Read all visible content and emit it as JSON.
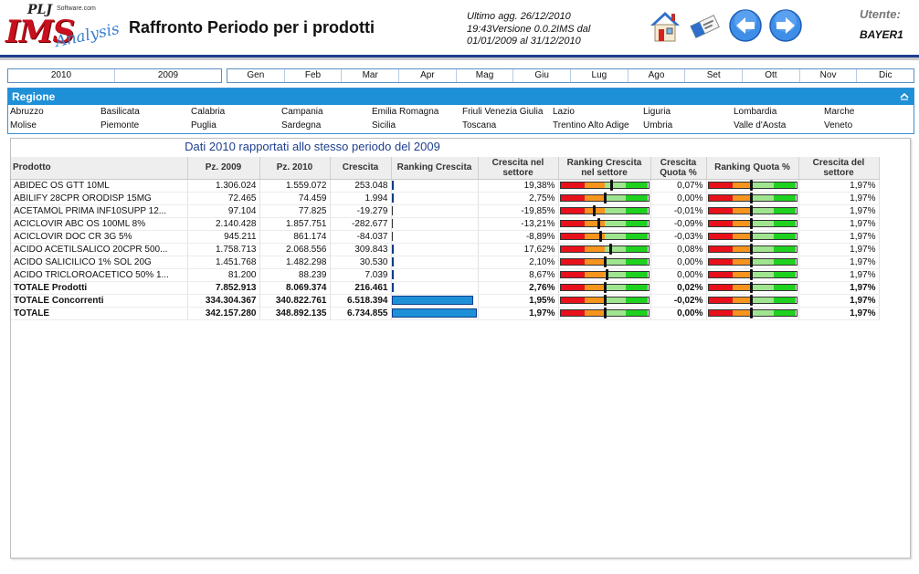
{
  "header": {
    "logo_text": "IMS",
    "logo_company": "PLJ",
    "logo_company_suffix": "Software.com",
    "logo_analysis": "Analysis",
    "title": "Raffronto Periodo per i prodotti",
    "info_line1": "Ultimo agg. 26/12/2010",
    "info_line2": "19:43Versione 0.0.2IMS dal",
    "info_line3": "01/01/2009 al 31/12/2010",
    "user_label": "Utente:",
    "user_name": "BAYER1"
  },
  "toolbar": {
    "home_icon": "home-icon",
    "eraser_icon": "eraser-icon",
    "back_icon": "arrow-left-icon",
    "forward_icon": "arrow-right-icon"
  },
  "years": [
    "2010",
    "2009"
  ],
  "months": [
    "Gen",
    "Feb",
    "Mar",
    "Apr",
    "Mag",
    "Giu",
    "Lug",
    "Ago",
    "Set",
    "Ott",
    "Nov",
    "Dic"
  ],
  "region": {
    "title": "Regione",
    "items": [
      "Abruzzo",
      "Basilicata",
      "Calabria",
      "Campania",
      "Emilia Romagna",
      "Friuli Venezia Giulia",
      "Lazio",
      "Liguria",
      "Lombardia",
      "Marche",
      "Molise",
      "Piemonte",
      "Puglia",
      "Sardegna",
      "Sicilia",
      "Toscana",
      "Trentino Alto Adige",
      "Umbria",
      "Valle d'Aosta",
      "Veneto"
    ]
  },
  "table": {
    "title": "Dati 2010 rapportati allo stesso periodo del 2009",
    "columns": [
      "Prodotto",
      "Pz. 2009",
      "Pz. 2010",
      "Crescita",
      "Ranking Crescita",
      "Crescita nel settore",
      "Ranking Crescita nel settore",
      "Crescita Quota %",
      "Ranking Quota %",
      "Crescita del settore"
    ],
    "rows": [
      {
        "name": "ABIDEC OS GTT 10ML",
        "pz2009": "1.306.024",
        "pz2010": "1.559.072",
        "crescita": "253.048",
        "rank": 0.03,
        "crescita_settore": "19,38%",
        "rank_settore": 0.58,
        "quota": "0,07%",
        "rank_quota": 0.48,
        "settore": "1,97%",
        "neg": false
      },
      {
        "name": "ABILIFY 28CPR ORODISP 15MG",
        "pz2009": "72.465",
        "pz2010": "74.459",
        "crescita": "1.994",
        "rank": 0.01,
        "crescita_settore": "2,75%",
        "rank_settore": 0.5,
        "quota": "0,00%",
        "rank_quota": 0.48,
        "settore": "1,97%",
        "neg": false
      },
      {
        "name": "ACETAMOL PRIMA INF10SUPP 12...",
        "pz2009": "97.104",
        "pz2010": "77.825",
        "crescita": "-19.279",
        "rank": 0.0,
        "crescita_settore": "-19,85%",
        "rank_settore": 0.38,
        "quota": "-0,01%",
        "rank_quota": 0.48,
        "settore": "1,97%",
        "neg": true
      },
      {
        "name": "ACICLOVIR ABC OS 100ML 8%",
        "pz2009": "2.140.428",
        "pz2010": "1.857.751",
        "crescita": "-282.677",
        "rank": 0.0,
        "crescita_settore": "-13,21%",
        "rank_settore": 0.43,
        "quota": "-0,09%",
        "rank_quota": 0.48,
        "settore": "1,97%",
        "neg": true
      },
      {
        "name": "ACICLOVIR DOC CR 3G 5%",
        "pz2009": "945.211",
        "pz2010": "861.174",
        "crescita": "-84.037",
        "rank": 0.0,
        "crescita_settore": "-8,89%",
        "rank_settore": 0.45,
        "quota": "-0,03%",
        "rank_quota": 0.48,
        "settore": "1,97%",
        "neg": true
      },
      {
        "name": "ACIDO ACETILSALICO 20CPR 500...",
        "pz2009": "1.758.713",
        "pz2010": "2.068.556",
        "crescita": "309.843",
        "rank": 0.03,
        "crescita_settore": "17,62%",
        "rank_settore": 0.57,
        "quota": "0,08%",
        "rank_quota": 0.48,
        "settore": "1,97%",
        "neg": false
      },
      {
        "name": "ACIDO SALICILICO 1% SOL 20G",
        "pz2009": "1.451.768",
        "pz2010": "1.482.298",
        "crescita": "30.530",
        "rank": 0.01,
        "crescita_settore": "2,10%",
        "rank_settore": 0.5,
        "quota": "0,00%",
        "rank_quota": 0.48,
        "settore": "1,97%",
        "neg": false
      },
      {
        "name": "ACIDO TRICLOROACETICO 50% 1...",
        "pz2009": "81.200",
        "pz2010": "88.239",
        "crescita": "7.039",
        "rank": 0.01,
        "crescita_settore": "8,67%",
        "rank_settore": 0.53,
        "quota": "0,00%",
        "rank_quota": 0.48,
        "settore": "1,97%",
        "neg": false
      }
    ],
    "totals": [
      {
        "name": "TOTALE Prodotti",
        "pz2009": "7.852.913",
        "pz2010": "8.069.374",
        "crescita": "216.461",
        "rank": 0.03,
        "crescita_settore": "2,76%",
        "rank_settore": 0.5,
        "quota": "0,02%",
        "rank_quota": 0.48,
        "settore": "1,97%",
        "kind": "prod"
      },
      {
        "name": "TOTALE Concorrenti",
        "pz2009": "334.304.367",
        "pz2010": "340.822.761",
        "crescita": "6.518.394",
        "rank": 0.96,
        "crescita_settore": "1,95%",
        "rank_settore": 0.5,
        "quota": "-0,02%",
        "rank_quota": 0.48,
        "settore": "1,97%",
        "kind": "conc"
      },
      {
        "name": "TOTALE",
        "pz2009": "342.157.280",
        "pz2010": "348.892.135",
        "crescita": "6.734.855",
        "rank": 1.0,
        "crescita_settore": "1,97%",
        "rank_settore": 0.5,
        "quota": "0,00%",
        "rank_quota": 0.48,
        "settore": "1,97%",
        "kind": "all"
      }
    ]
  },
  "colors": {
    "accent": "#1e90d8",
    "gauge_red": "#e8111b",
    "gauge_orange": "#f7941d",
    "gauge_lightgreen": "#9fe58f",
    "gauge_green": "#1fd21f"
  }
}
